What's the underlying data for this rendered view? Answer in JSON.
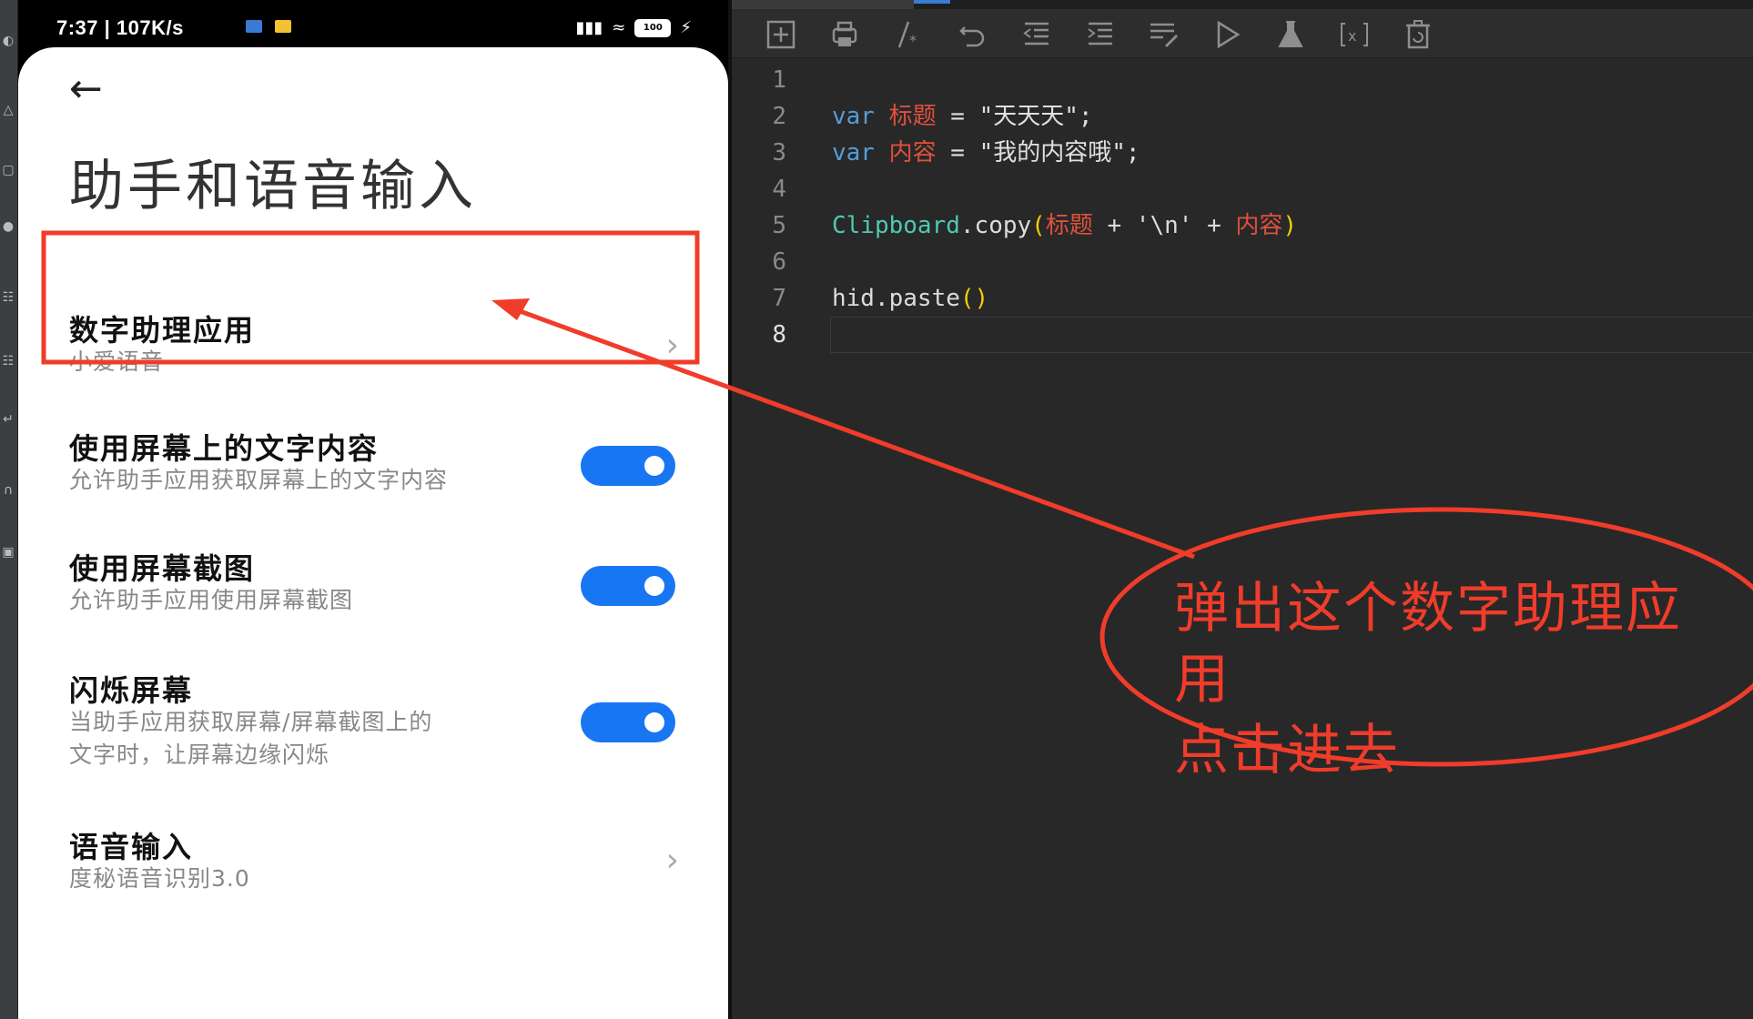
{
  "phone": {
    "status": {
      "time_speed": "7:37 | 107K/s",
      "signal_icons": "▓▓ ◓",
      "battery": "100"
    },
    "page_title": "助手和语音输入",
    "back_icon": "left-arrow-icon",
    "items": [
      {
        "title": "数字助理应用",
        "subtitle": "小爱语音",
        "control": "chevron"
      },
      {
        "title": "使用屏幕上的文字内容",
        "subtitle": "允许助手应用获取屏幕上的文字内容",
        "control": "toggle",
        "on": true
      },
      {
        "title": "使用屏幕截图",
        "subtitle": "允许助手应用使用屏幕截图",
        "control": "toggle",
        "on": true
      },
      {
        "title": "闪烁屏幕",
        "subtitle_line1": "当助手应用获取屏幕/屏幕截图上的",
        "subtitle_line2": "文字时，让屏幕边缘闪烁",
        "control": "toggle",
        "on": true
      },
      {
        "title": "语音输入",
        "subtitle": "度秘语音识别3.0",
        "control": "chevron"
      }
    ],
    "toggle_color": "#1976f2"
  },
  "editor": {
    "toolbar": [
      "new-file-icon",
      "print-icon",
      "comment-icon",
      "undo-icon",
      "outdent-icon",
      "indent-icon",
      "format-icon",
      "run-icon",
      "flask-icon",
      "variable-icon",
      "delete-icon"
    ],
    "line_numbers": [
      "1",
      "2",
      "3",
      "4",
      "5",
      "6",
      "7",
      "8"
    ],
    "code": {
      "l2_kw": "var",
      "l2_id": "标题",
      "l2_rest": " = \"天天天\";",
      "l3_kw": "var",
      "l3_id": "内容",
      "l3_rest": " = \"我的内容哦\";",
      "l5_cls": "Clipboard",
      "l5_method": ".copy",
      "l5_open": "(",
      "l5_id1": "标题",
      "l5_mid": " + '\\n' + ",
      "l5_id2": "内容",
      "l5_close": ")",
      "l7_text": "hid.paste",
      "l7_parens": "()"
    }
  },
  "annotation": {
    "line1": "弹出这个数字助理应用",
    "line2": "点击进去",
    "color": "#f03c2a"
  }
}
